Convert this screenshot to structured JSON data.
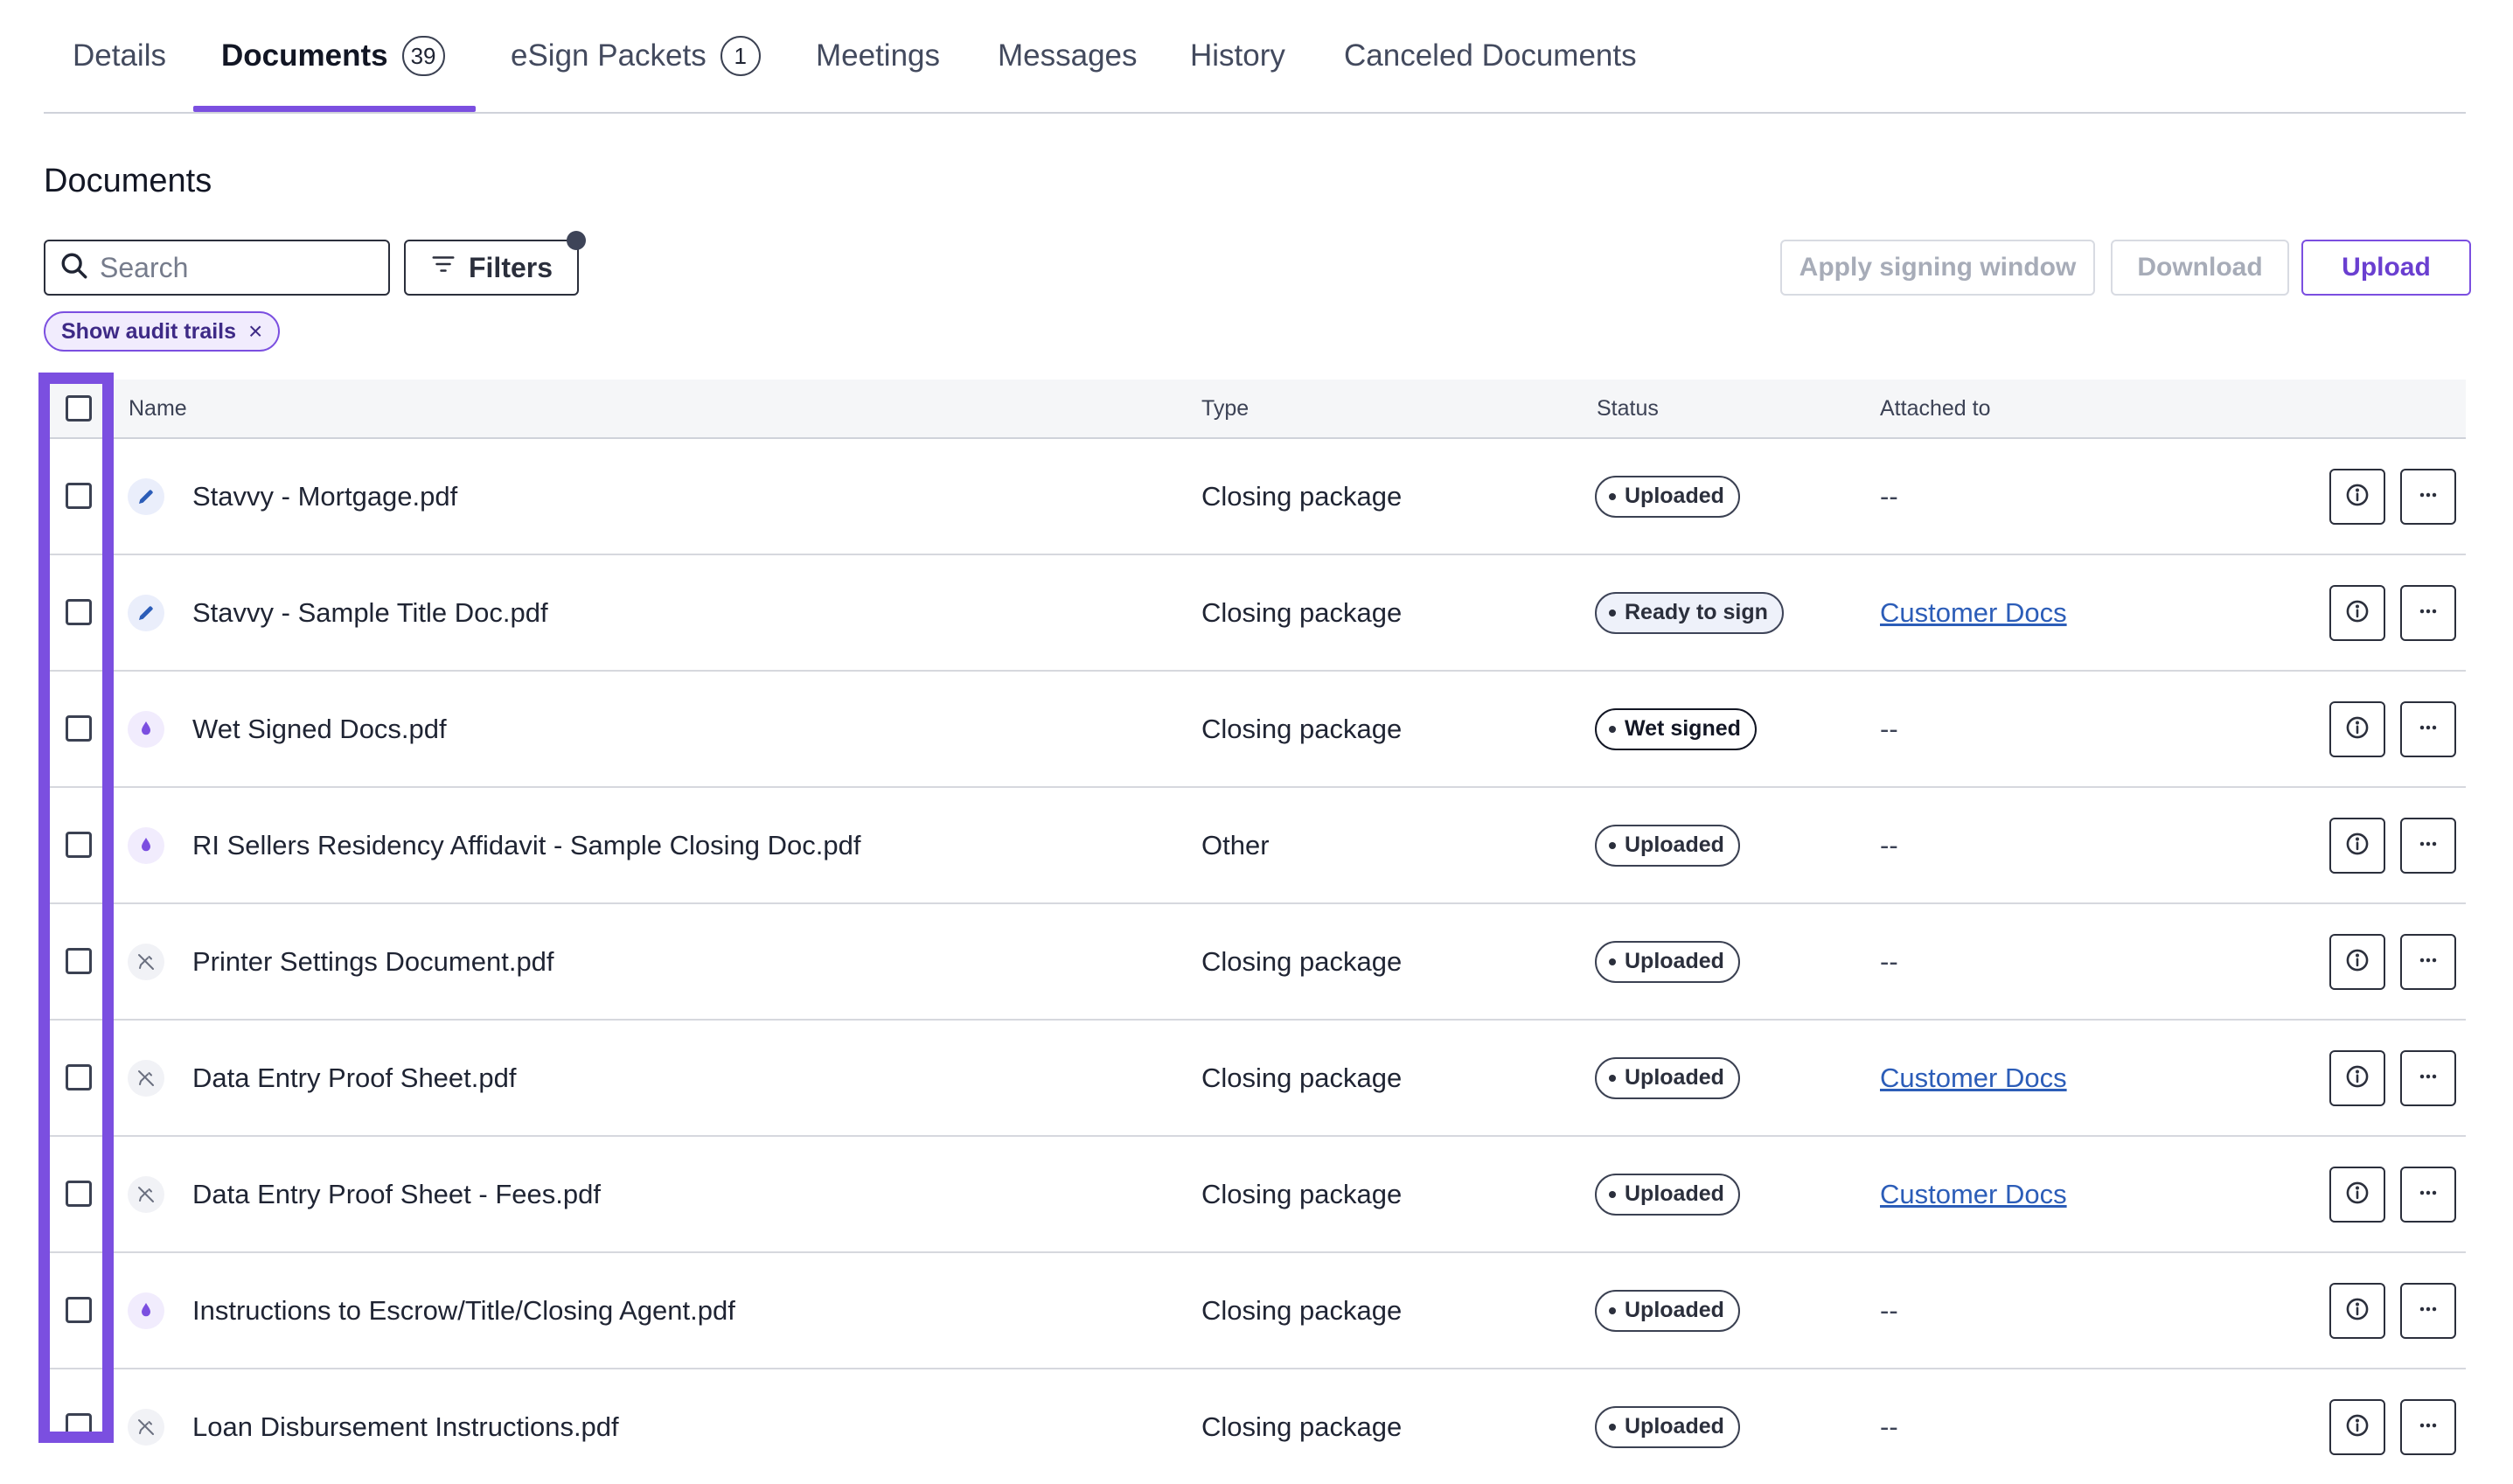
{
  "tabs": [
    {
      "label": "Details"
    },
    {
      "label": "Documents",
      "count": "39"
    },
    {
      "label": "eSign Packets",
      "count": "1"
    },
    {
      "label": "Meetings"
    },
    {
      "label": "Messages"
    },
    {
      "label": "History"
    },
    {
      "label": "Canceled Documents"
    }
  ],
  "section_title": "Documents",
  "search": {
    "placeholder": "Search",
    "value": ""
  },
  "toolbar": {
    "filters_label": "Filters",
    "apply_signing_window_label": "Apply signing window",
    "download_label": "Download",
    "upload_label": "Upload"
  },
  "chip": {
    "label": "Show audit trails",
    "close": "×"
  },
  "table": {
    "headers": {
      "name": "Name",
      "type": "Type",
      "status": "Status",
      "attached_to": "Attached to"
    },
    "rows": [
      {
        "icon": "pen-icon",
        "name": "Stavvy - Mortgage.pdf",
        "type": "Closing package",
        "status": "Uploaded",
        "attached_to": "--"
      },
      {
        "icon": "pen-icon",
        "name": "Stavvy - Sample Title Doc.pdf",
        "type": "Closing package",
        "status": "Ready to sign",
        "attached_to": "Customer Docs"
      },
      {
        "icon": "ink-drop-icon",
        "name": "Wet Signed Docs.pdf",
        "type": "Closing package",
        "status": "Wet signed",
        "attached_to": "--"
      },
      {
        "icon": "ink-drop-icon",
        "name": "RI Sellers Residency Affidavit - Sample Closing Doc.pdf",
        "type": "Other",
        "status": "Uploaded",
        "attached_to": "--"
      },
      {
        "icon": "no-signature-icon",
        "name": "Printer Settings Document.pdf",
        "type": "Closing package",
        "status": "Uploaded",
        "attached_to": "--"
      },
      {
        "icon": "no-signature-icon",
        "name": "Data Entry Proof Sheet.pdf",
        "type": "Closing package",
        "status": "Uploaded",
        "attached_to": "Customer Docs"
      },
      {
        "icon": "no-signature-icon",
        "name": "Data Entry Proof Sheet - Fees.pdf",
        "type": "Closing package",
        "status": "Uploaded",
        "attached_to": "Customer Docs"
      },
      {
        "icon": "ink-drop-icon",
        "name": "Instructions to Escrow/Title/Closing Agent.pdf",
        "type": "Closing package",
        "status": "Uploaded",
        "attached_to": "--"
      },
      {
        "icon": "no-signature-icon",
        "name": "Loan Disbursement Instructions.pdf",
        "type": "Closing package",
        "status": "Uploaded",
        "attached_to": "--"
      }
    ]
  },
  "colors": {
    "accent": "#7b4fe0",
    "link": "#2c5db8",
    "text": "#1f2433"
  }
}
